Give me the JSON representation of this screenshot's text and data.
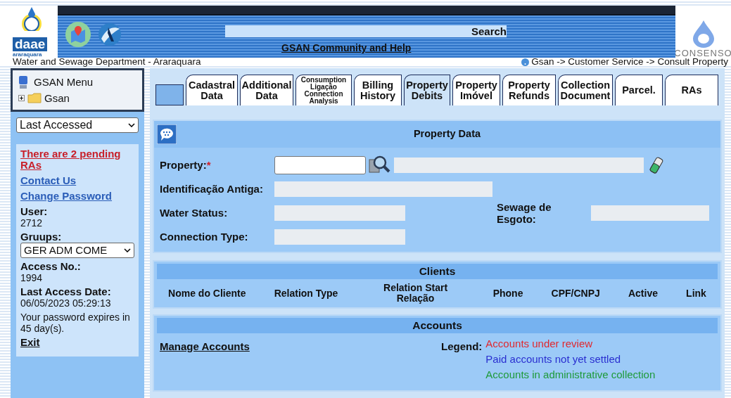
{
  "header": {
    "logo_text": "daae",
    "logo_subtext": "araraquara",
    "search_label": "Search",
    "community_link": "GSAN Community and Help",
    "partner_logo_text": "CONSENSO",
    "department": "Water and Sewage Department - Araraquara",
    "breadcrumb": "Gsan -> Customer Service -> Consult Property"
  },
  "sidebar": {
    "menu_title": "GSAN Menu",
    "tree": [
      {
        "label": "Gsan",
        "expanded": false
      }
    ],
    "last_accessed": "Last Accessed",
    "links": [
      {
        "label": "There are 2 pending RAs",
        "kind": "alert"
      },
      {
        "label": "Contact Us",
        "kind": "link"
      },
      {
        "label": "Change Password",
        "kind": "link"
      }
    ],
    "user_label": "User:",
    "user": "2712",
    "groups_label": "Gruups:",
    "group": "GER ADM COME",
    "access_label": "Access No.:",
    "access_no": "1994",
    "last_access_label": "Last Access Date:",
    "last_access": "06/05/2023 05:29:13",
    "password_note": "Your password expires in 45 day(s).",
    "exit": "Exit"
  },
  "tabs": [
    {
      "label": "Cadastral Data",
      "selected": false,
      "kind": "normal"
    },
    {
      "label": "Additional Data",
      "selected": false,
      "kind": "normal"
    },
    {
      "label": "Consumption Ligação Connection Analysis",
      "selected": false,
      "kind": "small"
    },
    {
      "label": "Billing History",
      "selected": false,
      "kind": "normal"
    },
    {
      "label": "Property Debits",
      "selected": true,
      "kind": "normal"
    },
    {
      "label": "Property Imóvel",
      "selected": false,
      "kind": "normal"
    },
    {
      "label": "Property Refunds",
      "selected": false,
      "kind": "normal"
    },
    {
      "label": "Collection Document",
      "selected": false,
      "kind": "normal"
    },
    {
      "label": "Parcel.",
      "selected": false,
      "kind": "normal"
    },
    {
      "label": "RAs",
      "selected": false,
      "kind": "normal"
    }
  ],
  "property_data": {
    "title": "Property Data",
    "property_label": "Property:",
    "required_marker": "*",
    "old_id_label": "Identificação Antiga:",
    "water_status_label": "Water Status:",
    "sewage_label": "Sewage de Esgoto:",
    "connection_type_label": "Connection Type:"
  },
  "clients": {
    "title": "Clients",
    "columns": [
      "Nome do Cliente",
      "Relation Type",
      "Relation Start Relação",
      "Phone",
      "CPF/CNPJ",
      "Active",
      "Link"
    ]
  },
  "accounts": {
    "title": "Accounts",
    "manage_link": "Manage Accounts",
    "legend_label": "Legend:",
    "legend": [
      {
        "label": "Accounts under review",
        "color": "#e0282e"
      },
      {
        "label": "Paid accounts not yet settled",
        "color": "#2a2fd0"
      },
      {
        "label": "Accounts in administrative collection",
        "color": "#1e9a3a"
      }
    ]
  }
}
